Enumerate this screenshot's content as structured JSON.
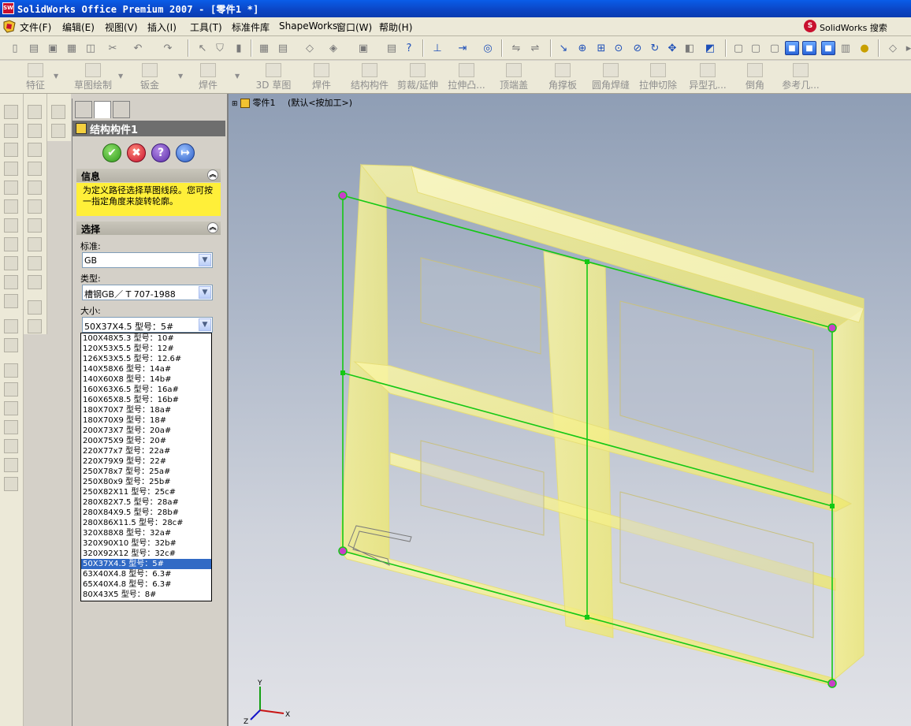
{
  "window": {
    "title": "SolidWorks Office Premium 2007 - [零件1 *]",
    "app_icon_label": "SW"
  },
  "menu": {
    "items": [
      "文件(F)",
      "编辑(E)",
      "视图(V)",
      "插入(I)",
      "工具(T)",
      "标准件库",
      "ShapeWorks",
      "窗口(W)",
      "帮助(H)"
    ],
    "search_label": "SolidWorks 搜索"
  },
  "command_manager": {
    "tabs": [
      "特征",
      "草图绘制",
      "钣金",
      "焊件",
      "3D 草图",
      "焊件",
      "结构构件",
      "剪裁/延伸",
      "拉伸凸...",
      "顶端盖",
      "角撑板",
      "圆角焊缝",
      "拉伸切除",
      "异型孔...",
      "倒角",
      "参考几..."
    ]
  },
  "property_manager": {
    "title": "结构构件1",
    "buttons": {
      "ok": "✔",
      "cancel": "✖",
      "help": "?",
      "pin": "↦"
    },
    "info": {
      "header": "信息",
      "message": "为定义路径选择草图线段。您可按一指定角度来旋转轮廓。"
    },
    "selection": {
      "header": "选择",
      "standard_label": "标准:",
      "standard_value": "GB",
      "type_label": "类型:",
      "type_value": "槽钢GB／ T 707-1988",
      "size_label": "大小:",
      "size_value": "50X37X4.5 型号：5#"
    },
    "size_options": [
      "100X48X5.3 型号：10#",
      "120X53X5.5 型号：12#",
      "126X53X5.5 型号：12.6#",
      "140X58X6 型号：14a#",
      "140X60X8 型号：14b#",
      "160X63X6.5 型号：16a#",
      "160X65X8.5 型号：16b#",
      "180X70X7 型号：18a#",
      "180X70X9 型号：18#",
      "200X73X7 型号：20a#",
      "200X75X9 型号：20#",
      "220X77x7 型号：22a#",
      "220X79X9 型号：22#",
      "250X78x7 型号：25a#",
      "250X80x9 型号：25b#",
      "250X82X11 型号：25c#",
      "280X82X7.5 型号：28a#",
      "280X84X9.5 型号：28b#",
      "280X86X11.5 型号：28c#",
      "320X88X8 型号：32a#",
      "320X90X10 型号：32b#",
      "320X92X12 型号：32c#",
      "50X37X4.5 型号：5#",
      "63X40X4.8 型号：6.3#",
      "65X40X4.8 型号：6.3#",
      "80X43X5 型号：8#"
    ],
    "selected_size_index": 22
  },
  "viewport": {
    "tree_label": "零件1",
    "config_label": "(默认<按加工>)",
    "triad": {
      "x": "X",
      "y": "Y",
      "z": "Z"
    }
  },
  "colors": {
    "accent": "#316ac5",
    "sketch_line": "#14c814",
    "part_fill": "#f5f07a",
    "info_bg": "#ffef39"
  }
}
